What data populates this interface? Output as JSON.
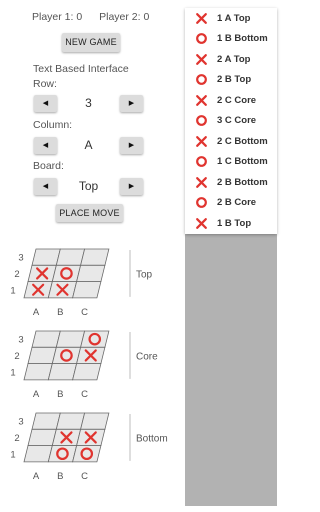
{
  "scores": {
    "player1": "Player 1: 0",
    "player2": "Player 2: 0"
  },
  "buttons": {
    "new_game": "NEW GAME",
    "place_move": "PLACE MOVE"
  },
  "interface": {
    "title": "Text Based Interface",
    "row_label": "Row:",
    "row_value": "3",
    "column_label": "Column:",
    "column_value": "A",
    "board_label": "Board:",
    "board_value": "Top",
    "prev_arrow": "◀",
    "next_arrow": "▶"
  },
  "boards": [
    {
      "name": "Top",
      "rows": [
        "3",
        "2",
        "1"
      ],
      "cols": [
        "A",
        "B",
        "C"
      ],
      "cells": [
        [
          "",
          "",
          ""
        ],
        [
          "X",
          "O",
          ""
        ],
        [
          "X",
          "X",
          ""
        ]
      ]
    },
    {
      "name": "Core",
      "rows": [
        "3",
        "2",
        "1"
      ],
      "cols": [
        "A",
        "B",
        "C"
      ],
      "cells": [
        [
          "",
          "",
          "O"
        ],
        [
          "",
          "O",
          "X"
        ],
        [
          "",
          "",
          ""
        ]
      ]
    },
    {
      "name": "Bottom",
      "rows": [
        "3",
        "2",
        "1"
      ],
      "cols": [
        "A",
        "B",
        "C"
      ],
      "cells": [
        [
          "",
          "",
          ""
        ],
        [
          "",
          "X",
          "X"
        ],
        [
          "",
          "O",
          "O"
        ]
      ]
    }
  ],
  "moves": [
    {
      "mark": "X",
      "text": "1 A Top"
    },
    {
      "mark": "O",
      "text": "1 B Bottom"
    },
    {
      "mark": "X",
      "text": "2 A Top"
    },
    {
      "mark": "O",
      "text": "2 B Top"
    },
    {
      "mark": "X",
      "text": "2 C Core"
    },
    {
      "mark": "O",
      "text": "3 C Core"
    },
    {
      "mark": "X",
      "text": "2 C Bottom"
    },
    {
      "mark": "O",
      "text": "1 C Bottom"
    },
    {
      "mark": "X",
      "text": "2 B Bottom"
    },
    {
      "mark": "O",
      "text": "2 B Core"
    },
    {
      "mark": "X",
      "text": "1 B Top"
    }
  ],
  "colors": {
    "mark": "#e0342f",
    "cell": "#e8e8e8",
    "line": "#6a6a6a"
  }
}
